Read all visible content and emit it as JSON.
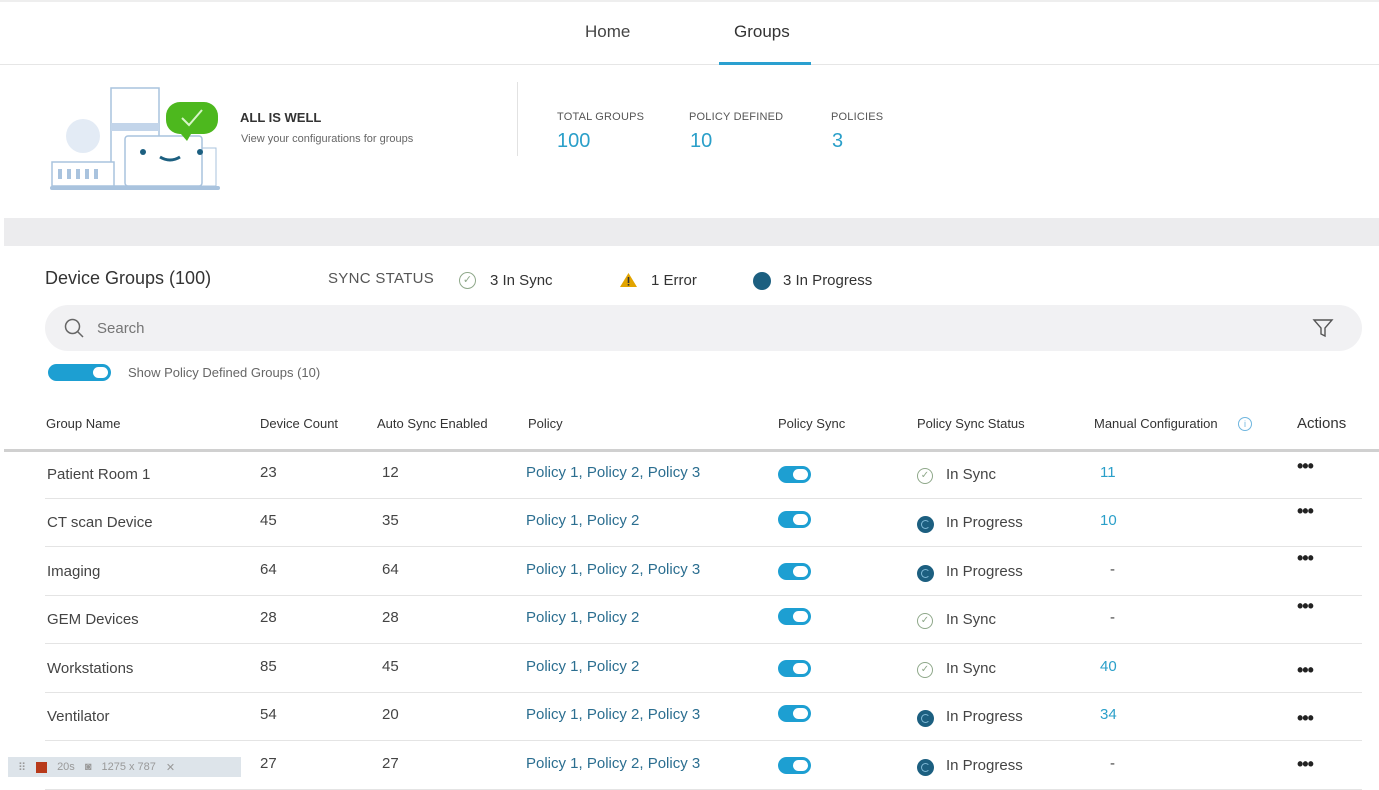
{
  "nav": {
    "tabs": [
      {
        "label": "Home"
      },
      {
        "label": "Groups",
        "active": true
      }
    ]
  },
  "hero": {
    "title": "ALL IS WELL",
    "subtitle": "View your configurations for groups"
  },
  "stats": [
    {
      "label": "TOTAL GROUPS",
      "value": "100"
    },
    {
      "label": "POLICY DEFINED",
      "value": "10"
    },
    {
      "label": "POLICIES",
      "value": "3"
    }
  ],
  "groups": {
    "title": "Device Groups (100)",
    "sync_label": "SYNC STATUS",
    "in_sync": "3 In Sync",
    "error": "1 Error",
    "in_progress": "3 In Progress",
    "search_placeholder": "Search",
    "toggle_label": "Show Policy Defined Groups (10)"
  },
  "table": {
    "headers": [
      "Group Name",
      "Device Count",
      "Auto Sync Enabled",
      "Policy",
      "Policy Sync",
      "Policy Sync Status",
      "Manual Configuration",
      "Actions"
    ],
    "rows": [
      {
        "name": "Patient  Room 1",
        "count": "23",
        "auto": "12",
        "policy": "Policy 1, Policy 2, Policy 3",
        "status": "In Sync",
        "manual": "11"
      },
      {
        "name": "CT scan Device",
        "count": "45",
        "auto": "35",
        "policy": "Policy 1, Policy 2",
        "status": "In Progress",
        "manual": "10"
      },
      {
        "name": "Imaging",
        "count": "64",
        "auto": "64",
        "policy": "Policy 1, Policy 2, Policy 3",
        "status": "In Progress",
        "manual": "-"
      },
      {
        "name": "GEM Devices",
        "count": "28",
        "auto": "28",
        "policy": "Policy 1, Policy 2",
        "status": "In Sync",
        "manual": "-"
      },
      {
        "name": "Workstations",
        "count": "85",
        "auto": "45",
        "policy": "Policy 1, Policy 2",
        "status": "In Sync",
        "manual": "40"
      },
      {
        "name": "Ventilator",
        "count": "54",
        "auto": "20",
        "policy": "Policy 1, Policy 2, Policy 3",
        "status": "In Progress",
        "manual": "34"
      },
      {
        "name": "",
        "count": "27",
        "auto": "27",
        "policy": "Policy 1, Policy 2, Policy 3",
        "status": "In Progress",
        "manual": "-"
      }
    ]
  },
  "recorder": {
    "time": "20s",
    "size": "1275 x 787"
  },
  "colors": {
    "accent": "#2aa0d0",
    "progress": "#1c5f80",
    "warning": "#e2a400",
    "success": "#4db81e"
  }
}
